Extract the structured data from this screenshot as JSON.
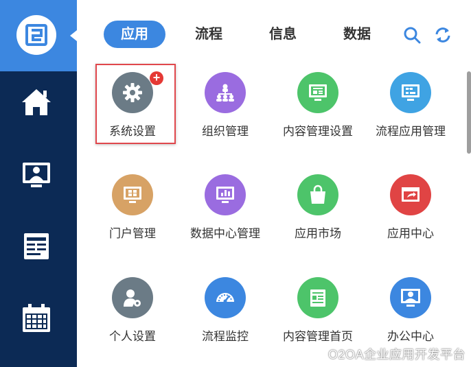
{
  "sidebar": {
    "icons": [
      "logo-icon",
      "home-icon",
      "desktop-user-icon",
      "document-icon",
      "calendar-icon"
    ]
  },
  "tabs": [
    {
      "label": "应用",
      "active": true
    },
    {
      "label": "流程",
      "active": false
    },
    {
      "label": "信息",
      "active": false
    },
    {
      "label": "数据",
      "active": false
    }
  ],
  "toolbar": {
    "icons": [
      "search-icon",
      "refresh-icon"
    ]
  },
  "apps": [
    {
      "label": "系统设置",
      "icon": "gear-icon",
      "color": "#6b7b86",
      "selected": true
    },
    {
      "label": "组织管理",
      "icon": "org-chart-icon",
      "color": "#9a6ce0"
    },
    {
      "label": "内容管理设置",
      "icon": "content-monitor-icon",
      "color": "#4dc46a"
    },
    {
      "label": "流程应用管理",
      "icon": "process-monitor-icon",
      "color": "#3fa3e3"
    },
    {
      "label": "门户管理",
      "icon": "portal-icon",
      "color": "#d7a265"
    },
    {
      "label": "数据中心管理",
      "icon": "data-chart-icon",
      "color": "#9a6ce0"
    },
    {
      "label": "应用市场",
      "icon": "shopping-bag-icon",
      "color": "#4dc46a"
    },
    {
      "label": "应用中心",
      "icon": "app-window-icon",
      "color": "#e04444"
    },
    {
      "label": "个人设置",
      "icon": "user-settings-icon",
      "color": "#6b7b86"
    },
    {
      "label": "流程监控",
      "icon": "speedometer-icon",
      "color": "#3c87e0"
    },
    {
      "label": "内容管理首页",
      "icon": "content-home-icon",
      "color": "#4dc46a"
    },
    {
      "label": "办公中心",
      "icon": "office-user-icon",
      "color": "#3c87e0"
    }
  ],
  "watermark": "O2OA企业应用开发平台"
}
